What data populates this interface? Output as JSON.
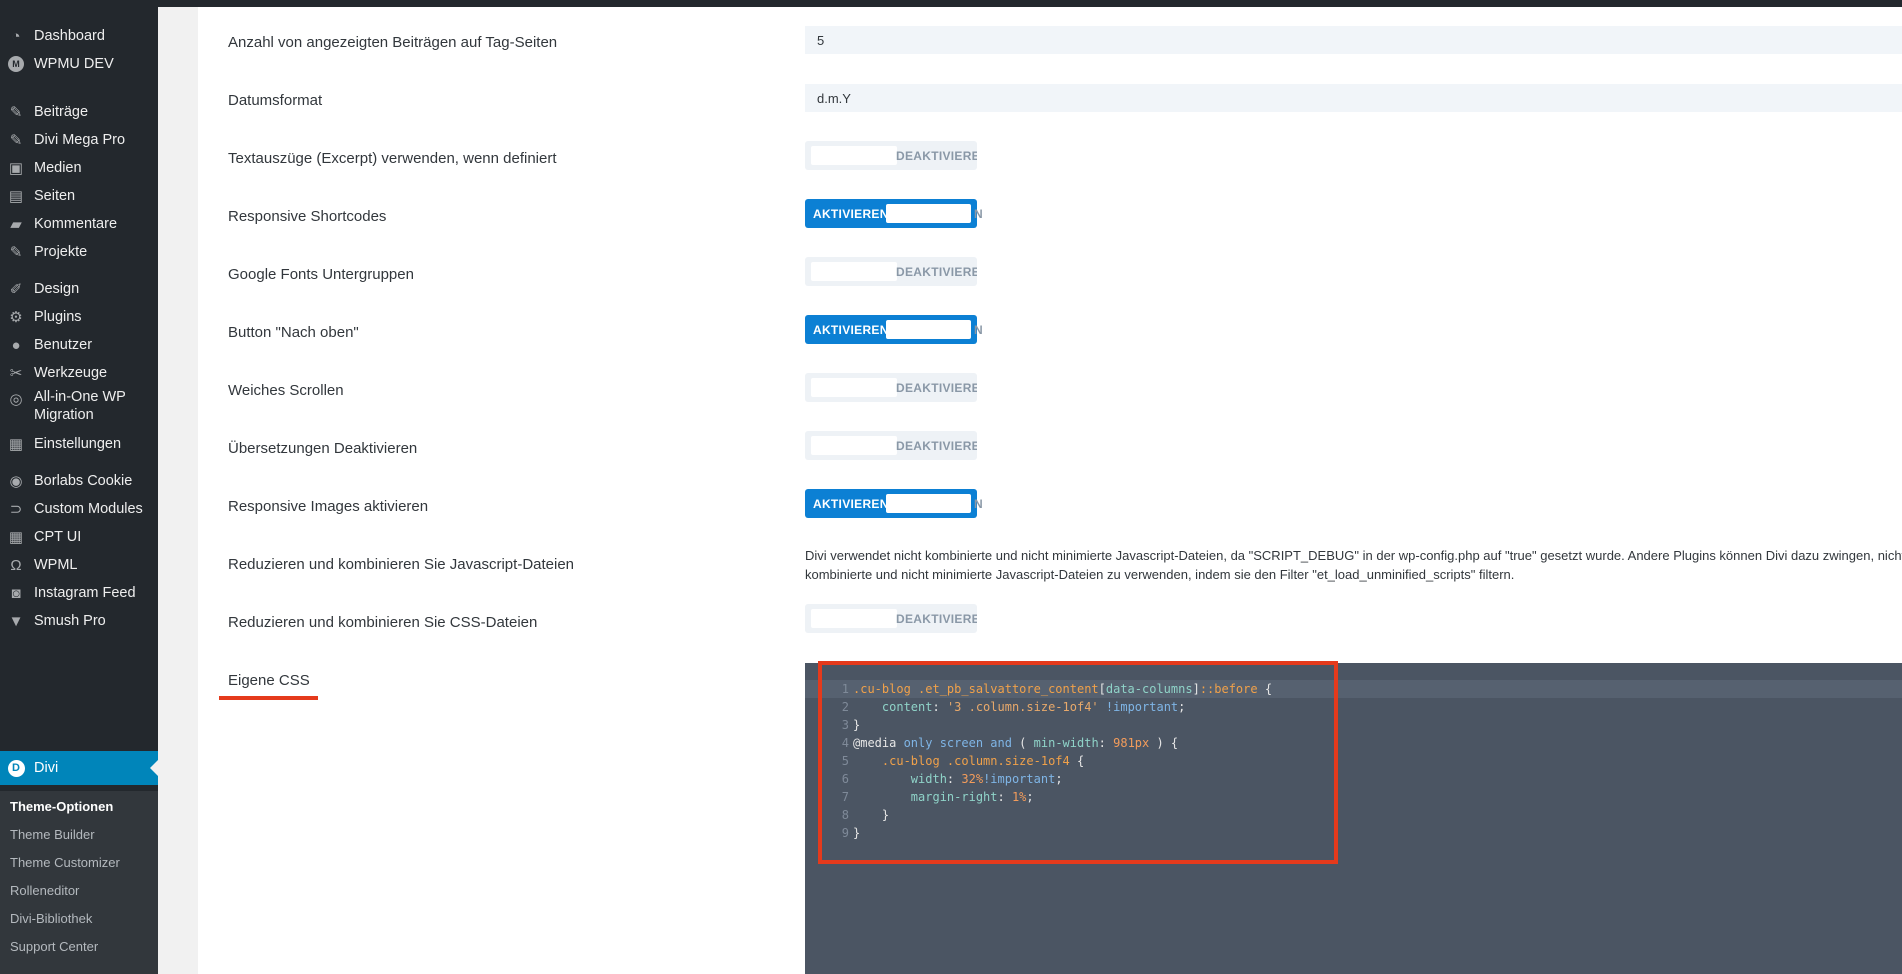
{
  "sidebar": {
    "items": [
      {
        "label": "Dashboard",
        "icon": "dashboard-icon"
      },
      {
        "label": "WPMU DEV",
        "icon": "wpmudev-icon"
      },
      {
        "label": "Beiträge",
        "icon": "pin-icon"
      },
      {
        "label": "Divi Mega Pro",
        "icon": "pin-icon"
      },
      {
        "label": "Medien",
        "icon": "media-icon"
      },
      {
        "label": "Seiten",
        "icon": "pages-icon"
      },
      {
        "label": "Kommentare",
        "icon": "comment-icon"
      },
      {
        "label": "Projekte",
        "icon": "pin-icon"
      },
      {
        "label": "Design",
        "icon": "brush-icon"
      },
      {
        "label": "Plugins",
        "icon": "plugin-icon"
      },
      {
        "label": "Benutzer",
        "icon": "user-icon"
      },
      {
        "label": "Werkzeuge",
        "icon": "wrench-icon"
      },
      {
        "label": "All-in-One WP Migration",
        "icon": "migration-icon"
      },
      {
        "label": "Einstellungen",
        "icon": "settings-icon"
      },
      {
        "label": "Borlabs Cookie",
        "icon": "cookie-icon"
      },
      {
        "label": "Custom Modules",
        "icon": "modules-icon"
      },
      {
        "label": "CPT UI",
        "icon": "grid-icon"
      },
      {
        "label": "WPML",
        "icon": "wpml-icon"
      },
      {
        "label": "Instagram Feed",
        "icon": "camera-icon"
      },
      {
        "label": "Smush Pro",
        "icon": "smush-icon"
      },
      {
        "label": "Divi",
        "icon": "divi-icon"
      }
    ],
    "submenu": [
      "Theme-Optionen",
      "Theme Builder",
      "Theme Customizer",
      "Rolleneditor",
      "Divi-Bibliothek",
      "Support Center"
    ]
  },
  "settings": {
    "tag_posts_label": "Anzahl von angezeigten Beiträgen auf Tag-Seiten",
    "tag_posts_value": "5",
    "date_format_label": "Datumsformat",
    "date_format_value": "d.m.Y",
    "excerpt_label": "Textauszüge (Excerpt) verwenden, wenn definiert",
    "responsive_shortcodes_label": "Responsive Shortcodes",
    "google_fonts_label": "Google Fonts Untergruppen",
    "back_to_top_label": "Button \"Nach oben\"",
    "smooth_scroll_label": "Weiches Scrollen",
    "translations_label": "Übersetzungen Deaktivieren",
    "responsive_images_label": "Responsive Images aktivieren",
    "minify_js_label": "Reduzieren und kombinieren Sie Javascript-Dateien",
    "minify_js_notice_1": "Divi verwendet nicht kombinierte und nicht minimierte Javascript-Dateien, da \"SCRIPT_DEBUG\" in der wp-config.php auf \"true\" gesetzt wurde. Andere Plugins können Divi dazu zwingen, nicht",
    "minify_js_notice_2": "kombinierte und nicht minimierte Javascript-Dateien zu verwenden, indem sie den Filter \"et_load_unminified_scripts\" filtern.",
    "minify_css_label": "Reduzieren und kombinieren Sie CSS-Dateien",
    "custom_css_label": "Eigene CSS"
  },
  "toggle_text": {
    "off": "DEAKTIVIEREN",
    "on": "AKTIVIEREN",
    "tail": "N"
  },
  "toggles": {
    "excerpt": false,
    "responsive_shortcodes": true,
    "google_fonts": false,
    "back_to_top": true,
    "smooth_scroll": false,
    "translations": false,
    "responsive_images": true,
    "minify_css": false
  },
  "colors": {
    "accent": "#0085ba",
    "toggle_on": "#0c80d4",
    "highlight_red": "#e53a1c",
    "editor_bg": "#4b5563"
  },
  "code_lines": [
    [
      [
        "sel",
        ".cu-blog .et_pb_salvattore_content"
      ],
      [
        "p",
        "["
      ],
      [
        "prop",
        "data-columns"
      ],
      [
        "p",
        "]"
      ],
      [
        "sel",
        "::before"
      ],
      [
        "p",
        " {"
      ]
    ],
    [
      [
        "p",
        "    "
      ],
      [
        "prop",
        "content"
      ],
      [
        "p",
        ": "
      ],
      [
        "str",
        "'3 .column.size-1of4'"
      ],
      [
        "p",
        " "
      ],
      [
        "kw",
        "!important"
      ],
      [
        "p",
        ";"
      ]
    ],
    [
      [
        "p",
        "}"
      ]
    ],
    [
      [
        "p",
        "@media "
      ],
      [
        "kw",
        "only screen and"
      ],
      [
        "p",
        " ( "
      ],
      [
        "prop",
        "min-width"
      ],
      [
        "p",
        ": "
      ],
      [
        "num",
        "981px"
      ],
      [
        "p",
        " ) {"
      ]
    ],
    [
      [
        "p",
        "    "
      ],
      [
        "sel",
        ".cu-blog .column.size-1of4"
      ],
      [
        "p",
        " {"
      ]
    ],
    [
      [
        "p",
        "        "
      ],
      [
        "prop",
        "width"
      ],
      [
        "p",
        ": "
      ],
      [
        "num",
        "32%"
      ],
      [
        "kw",
        "!important"
      ],
      [
        "p",
        ";"
      ]
    ],
    [
      [
        "p",
        "        "
      ],
      [
        "prop",
        "margin-right"
      ],
      [
        "p",
        ": "
      ],
      [
        "num",
        "1%"
      ],
      [
        "p",
        ";"
      ]
    ],
    [
      [
        "p",
        "    }"
      ]
    ],
    [
      [
        "p",
        "}"
      ]
    ]
  ]
}
